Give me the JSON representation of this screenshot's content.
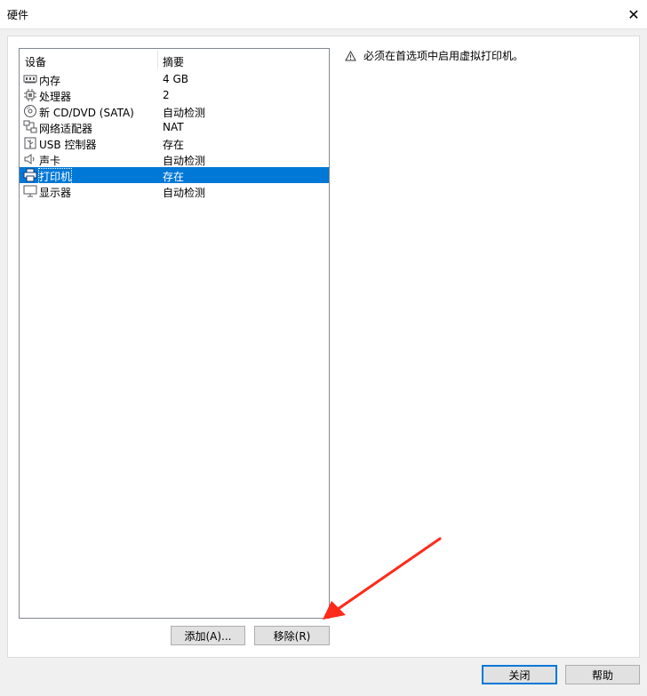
{
  "window": {
    "title": "硬件",
    "close_glyph": "✕"
  },
  "device_list": {
    "columns": [
      "设备",
      "摘要"
    ],
    "rows": [
      {
        "name": "内存",
        "summary": "4 GB",
        "icon": "memory-icon"
      },
      {
        "name": "处理器",
        "summary": "2",
        "icon": "processor-icon"
      },
      {
        "name": "新 CD/DVD (SATA)",
        "summary": "自动检测",
        "icon": "cd-dvd-icon"
      },
      {
        "name": "网络适配器",
        "summary": "NAT",
        "icon": "network-adapter-icon"
      },
      {
        "name": "USB 控制器",
        "summary": "存在",
        "icon": "usb-controller-icon"
      },
      {
        "name": "声卡",
        "summary": "自动检测",
        "icon": "sound-card-icon"
      },
      {
        "name": "打印机",
        "summary": "存在",
        "icon": "printer-icon",
        "selected": true
      },
      {
        "name": "显示器",
        "summary": "自动检测",
        "icon": "display-icon"
      }
    ]
  },
  "details": {
    "warning_text": "必须在首选项中启用虚拟打印机。"
  },
  "buttons": {
    "add_label": "添加(A)...",
    "remove_label": "移除(R)",
    "close_label": "关闭",
    "help_label": "帮助"
  },
  "colors": {
    "selection": "#0078d7",
    "annotation_arrow": "#ff2a1a"
  }
}
